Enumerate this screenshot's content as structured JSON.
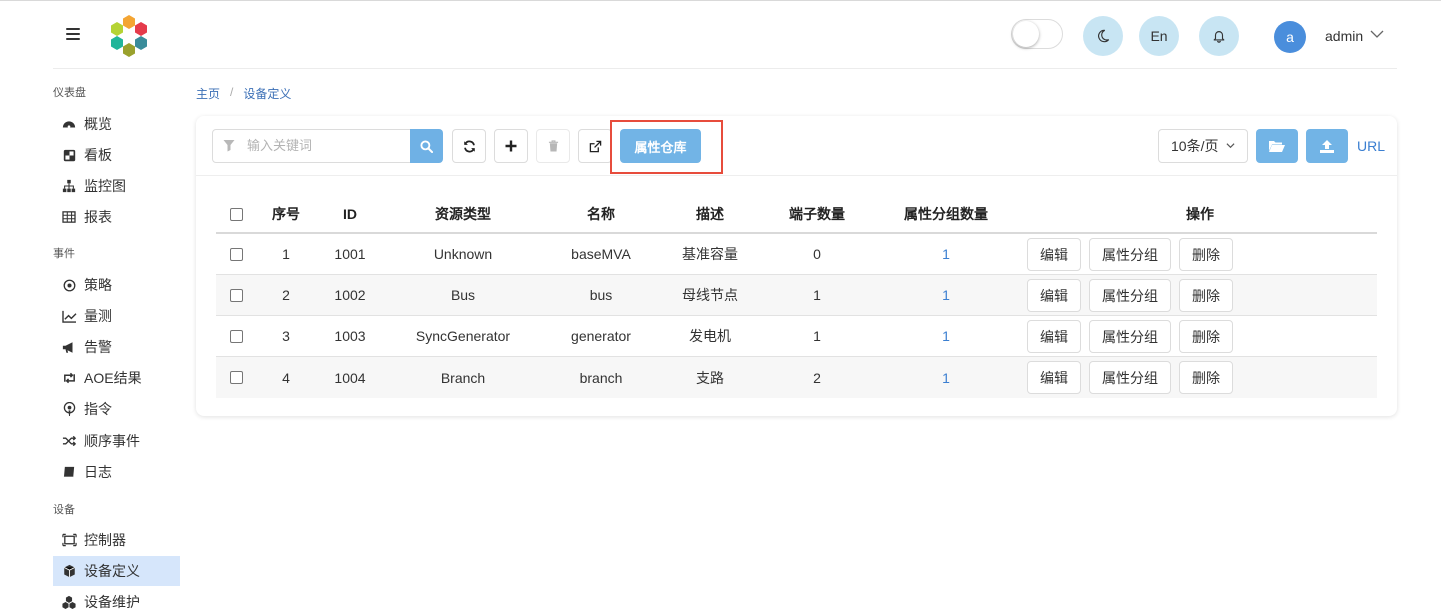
{
  "header": {
    "theme_toggle_on": false,
    "lang_label": "En",
    "avatar_letter": "a",
    "user_name": "admin",
    "accent": "#c8e5f3"
  },
  "sidebar": {
    "sections": [
      {
        "label": "仪表盘"
      },
      {
        "label": "事件"
      },
      {
        "label": "设备"
      }
    ],
    "items": [
      {
        "label": "概览",
        "icon": "dashboard-icon"
      },
      {
        "label": "看板",
        "icon": "board-icon"
      },
      {
        "label": "监控图",
        "icon": "sitemap-icon"
      },
      {
        "label": "报表",
        "icon": "table-icon"
      },
      {
        "label": "策略",
        "icon": "policy-icon"
      },
      {
        "label": "量测",
        "icon": "line-chart-icon"
      },
      {
        "label": "告警",
        "icon": "bullhorn-icon"
      },
      {
        "label": "AOE结果",
        "icon": "retweet-icon"
      },
      {
        "label": "指令",
        "icon": "podcast-icon"
      },
      {
        "label": "顺序事件",
        "icon": "random-icon"
      },
      {
        "label": "日志",
        "icon": "book-icon"
      },
      {
        "label": "控制器",
        "icon": "controller-icon"
      },
      {
        "label": "设备定义",
        "icon": "cube-icon",
        "active": true
      },
      {
        "label": "设备维护",
        "icon": "cubes-icon"
      }
    ]
  },
  "breadcrumb": {
    "home": "主页",
    "separator": "/",
    "current": "设备定义"
  },
  "toolbar": {
    "search_placeholder": "输入关键词",
    "property_repo_label": "属性仓库",
    "page_size_label": "10条/页",
    "url_label": "URL"
  },
  "table": {
    "headers": {
      "index": "序号",
      "id": "ID",
      "resource_type": "资源类型",
      "name": "名称",
      "description": "描述",
      "terminal_count": "端子数量",
      "prop_group_count": "属性分组数量",
      "actions": "操作"
    },
    "rows": [
      {
        "index": "1",
        "id": "1001",
        "resource_type": "Unknown",
        "name": "baseMVA",
        "description": "基准容量",
        "terminal_count": "0",
        "prop_group_count": "1"
      },
      {
        "index": "2",
        "id": "1002",
        "resource_type": "Bus",
        "name": "bus",
        "description": "母线节点",
        "terminal_count": "1",
        "prop_group_count": "1"
      },
      {
        "index": "3",
        "id": "1003",
        "resource_type": "SyncGenerator",
        "name": "generator",
        "description": "发电机",
        "terminal_count": "1",
        "prop_group_count": "1"
      },
      {
        "index": "4",
        "id": "1004",
        "resource_type": "Branch",
        "name": "branch",
        "description": "支路",
        "terminal_count": "2",
        "prop_group_count": "1"
      }
    ],
    "action_labels": {
      "edit": "编辑",
      "prop_group": "属性分组",
      "delete": "删除"
    }
  }
}
